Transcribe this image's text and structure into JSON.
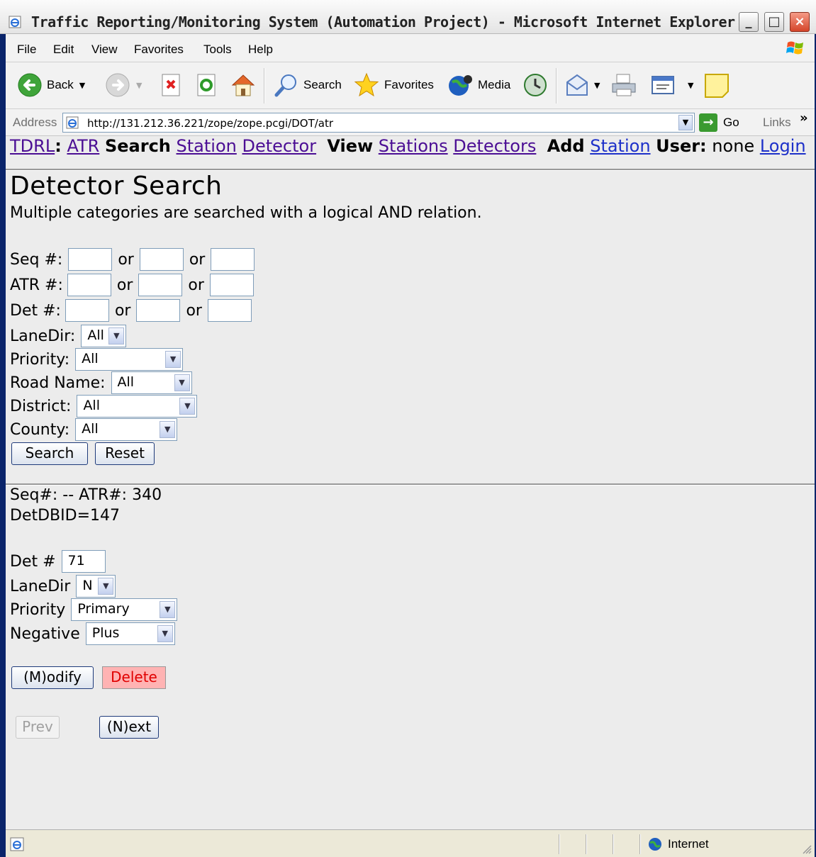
{
  "window": {
    "title": "Traffic Reporting/Monitoring System (Automation Project) - Microsoft Internet Explorer",
    "minimize": "_",
    "maximize": "□",
    "close": "×"
  },
  "menubar": [
    "File",
    "Edit",
    "View",
    "Favorites",
    "Tools",
    "Help"
  ],
  "toolbar": {
    "back": "Back",
    "search": "Search",
    "favorites": "Favorites",
    "media": "Media"
  },
  "address": {
    "label": "Address",
    "url": "http://131.212.36.221/zope/zope.pcgi/DOT/atr",
    "go": "Go",
    "links": "Links",
    "links_more": "»"
  },
  "nav": {
    "tdrl": "TDRL",
    "colon": ":",
    "atr": "ATR",
    "search_label": "Search",
    "station": "Station",
    "detector": "Detector",
    "view_label": "View",
    "stations": "Stations",
    "detectors": "Detectors",
    "add_label": "Add",
    "add_station": "Station",
    "user_label": "User:",
    "user_value": "none",
    "login": "Login"
  },
  "search_form": {
    "title": "Detector Search",
    "subtitle": "Multiple categories are searched with a logical AND relation.",
    "seq_label": "Seq #:",
    "atr_label": "ATR #:",
    "det_label": "Det #:",
    "or": "or",
    "lanedir_label": "LaneDir:",
    "lanedir_value": "All",
    "priority_label": "Priority:",
    "priority_value": "All",
    "road_label": "Road Name:",
    "road_value": "All",
    "district_label": "District:",
    "district_value": "All",
    "county_label": "County:",
    "county_value": "All",
    "search_button": "Search",
    "reset_button": "Reset"
  },
  "record": {
    "seq_line": "Seq#: -- ATR#: 340",
    "dbid_line": "DetDBID=147",
    "det_label": "Det #",
    "det_value": "71",
    "lanedir_label": "LaneDir",
    "lanedir_value": "N",
    "priority_label": "Priority",
    "priority_value": "Primary",
    "negative_label": "Negative",
    "negative_value": "Plus",
    "modify_button": "(M)odify",
    "delete_button": "Delete",
    "prev_button": "Prev",
    "next_button": "(N)ext"
  },
  "statusbar": {
    "zone": "Internet"
  },
  "colors": {
    "visited_link": "#4b0e94",
    "link": "#1d30c9",
    "delete_bg": "#ffb3b3",
    "delete_text": "#e00000",
    "page_bg": "#ececec"
  }
}
